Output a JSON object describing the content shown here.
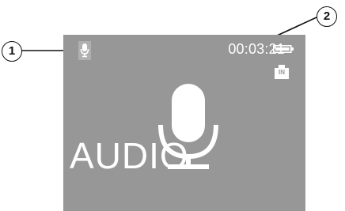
{
  "callouts": {
    "one": "1",
    "two": "2"
  },
  "status_bar": {
    "mode_icon": "microphone-icon",
    "elapsed_time": "00:03:21",
    "battery_icon": "battery-icon",
    "input_badge": "IN"
  },
  "main": {
    "center_icon": "microphone-icon",
    "mode_label": "AUDIO"
  },
  "colors": {
    "screen_background": "#979797",
    "foreground": "#ffffff",
    "callout_line": "#111111"
  }
}
